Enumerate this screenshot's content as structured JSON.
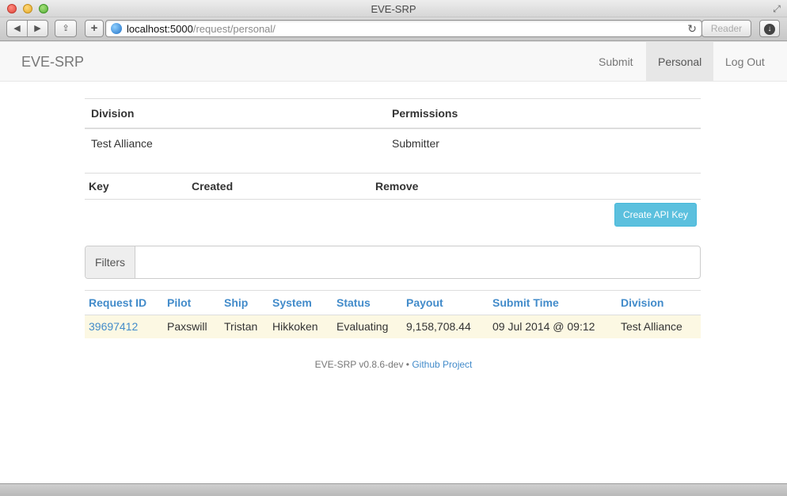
{
  "window": {
    "title": "EVE-SRP"
  },
  "browser": {
    "url_host": "localhost:5000",
    "url_path": "/request/personal/",
    "reader_label": "Reader"
  },
  "navbar": {
    "brand": "EVE-SRP",
    "items": [
      {
        "label": "Submit",
        "active": false
      },
      {
        "label": "Personal",
        "active": true
      },
      {
        "label": "Log Out",
        "active": false
      }
    ]
  },
  "permissions_table": {
    "headers": [
      "Division",
      "Permissions"
    ],
    "rows": [
      [
        "Test Alliance",
        "Submitter"
      ]
    ]
  },
  "keys_table": {
    "headers": [
      "Key",
      "Created",
      "Remove"
    ],
    "create_button": "Create API Key"
  },
  "filters": {
    "label": "Filters",
    "value": ""
  },
  "requests_table": {
    "headers": [
      "Request ID",
      "Pilot",
      "Ship",
      "System",
      "Status",
      "Payout",
      "Submit Time",
      "Division"
    ],
    "rows": [
      [
        "39697412",
        "Paxswill",
        "Tristan",
        "Hikkoken",
        "Evaluating",
        "9,158,708.44",
        "09 Jul 2014 @ 09:12",
        "Test Alliance"
      ]
    ]
  },
  "footer": {
    "version": "EVE-SRP v0.8.6-dev",
    "separator": " • ",
    "project_link": "Github Project"
  },
  "colors": {
    "link": "#428bca",
    "info_button": "#5bc0de",
    "row_warning": "#fcf8e3"
  }
}
